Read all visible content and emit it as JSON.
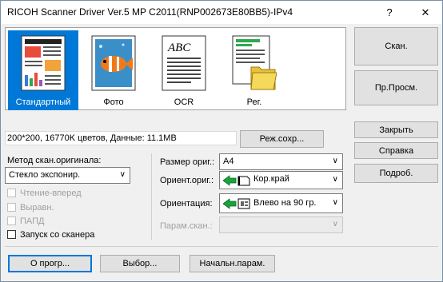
{
  "window": {
    "title": "RICOH Scanner Driver Ver.5 MP C2011(RNP002673E80BB5)-IPv4",
    "help_glyph": "?",
    "close_glyph": "✕"
  },
  "modes": [
    {
      "label": "Стандартный",
      "icon": "document-standard-icon",
      "selected": true
    },
    {
      "label": "Фото",
      "icon": "photo-fish-icon",
      "selected": false
    },
    {
      "label": "OCR",
      "icon": "ocr-abc-icon",
      "selected": false
    },
    {
      "label": "Рег.",
      "icon": "register-folder-icon",
      "selected": false
    }
  ],
  "mode_thumb_texts": {
    "ocr": "ABC"
  },
  "info": {
    "text": "200*200, 16770K цветов, Данные: 11.1MB",
    "save_mode_label": "Реж.сохр..."
  },
  "right_buttons": {
    "scan": "Скан.",
    "preview": "Пр.Просм.",
    "close": "Закрыть",
    "help": "Справка",
    "details": "Подроб."
  },
  "method": {
    "label": "Метод скан.оригинала:",
    "value": "Стекло экспонир."
  },
  "checkboxes": [
    {
      "label": "Чтение-вперед",
      "enabled": false,
      "checked": false
    },
    {
      "label": "Выравн.",
      "enabled": false,
      "checked": false
    },
    {
      "label": "ПАПД",
      "enabled": false,
      "checked": false
    },
    {
      "label": "Запуск со сканера",
      "enabled": true,
      "checked": false
    }
  ],
  "settings": {
    "size_label": "Размер ориг.:",
    "size_value": "A4",
    "orient_label": "Ориент.ориг.:",
    "orient_value": "Кор.край",
    "orientation_label": "Ориентация:",
    "orientation_value": "Влево на 90 гр.",
    "scan_param_label": "Парам.скан.:",
    "scan_param_value": ""
  },
  "bottom_buttons": {
    "about": "О прогр...",
    "select": "Выбор...",
    "defaults": "Начальн.парам."
  },
  "colors": {
    "accent": "#0078d7",
    "arrow_green": "#1aa33a"
  }
}
